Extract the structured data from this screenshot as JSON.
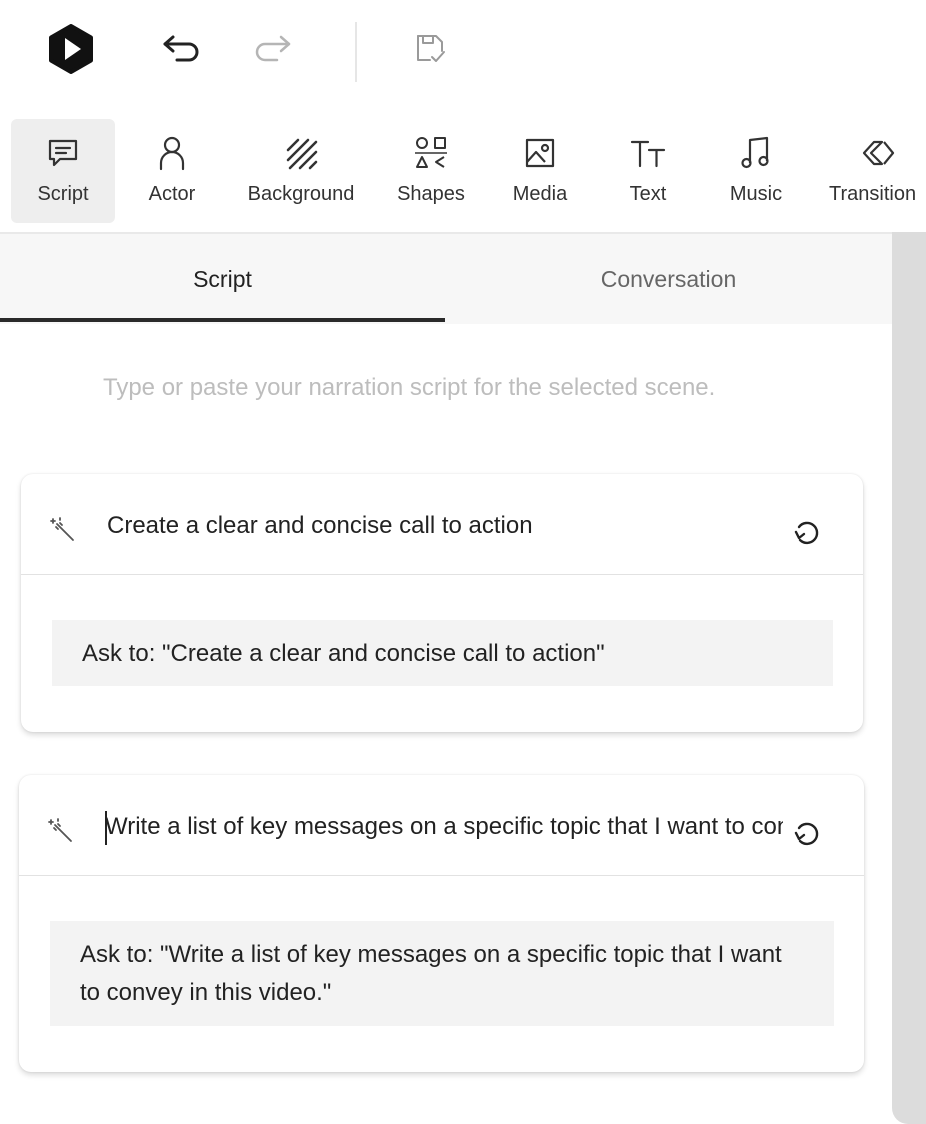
{
  "toolbar": {
    "tools": [
      {
        "label": "Script",
        "icon": "script-icon",
        "active": true
      },
      {
        "label": "Actor",
        "icon": "actor-icon"
      },
      {
        "label": "Background",
        "icon": "background-icon"
      },
      {
        "label": "Shapes",
        "icon": "shapes-icon"
      },
      {
        "label": "Media",
        "icon": "media-icon"
      },
      {
        "label": "Text",
        "icon": "text-icon"
      },
      {
        "label": "Music",
        "icon": "music-icon"
      },
      {
        "label": "Transition",
        "icon": "transition-icon"
      }
    ]
  },
  "tabs": {
    "script": "Script",
    "conversation": "Conversation",
    "active": "script"
  },
  "script_input": {
    "placeholder": "Type or paste your narration script for the selected scene."
  },
  "suggestions": [
    {
      "prompt": "Create a clear and concise call to action",
      "ask": "Ask to: \"Create a clear and concise call to action\""
    },
    {
      "prompt": "Write a list of key messages on a specific topic that I want to convey in this video.",
      "ask": "Ask to: \"Write a list of key messages on a specific topic that I want to convey in this video.\""
    }
  ],
  "colors": {
    "accent": "#2a2a2a",
    "tab_bg": "#f7f7f7",
    "ask_bg": "#f3f3f3",
    "scrollbar": "#dcdcdc"
  }
}
